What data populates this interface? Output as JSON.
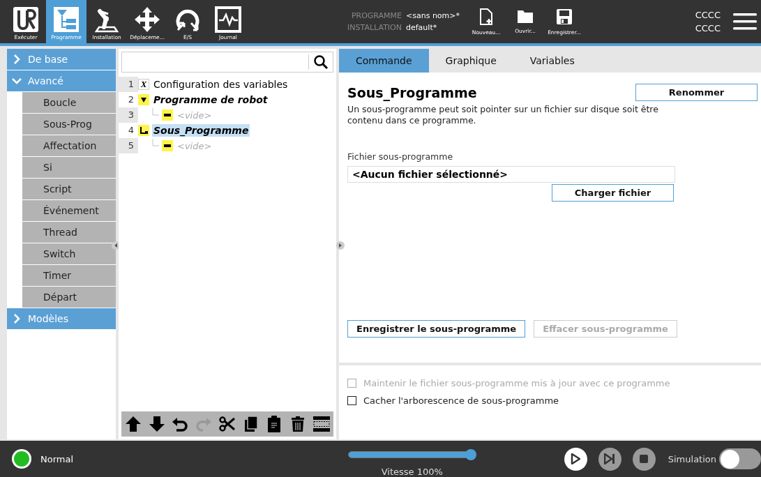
{
  "nav": [
    {
      "label": "Exécuter",
      "kind": "logo",
      "selected": false
    },
    {
      "label": "Programme",
      "kind": "tree",
      "selected": true
    },
    {
      "label": "Installation",
      "kind": "robot",
      "selected": false
    },
    {
      "label": "Déplaceme...",
      "kind": "move",
      "selected": false
    },
    {
      "label": "E/S",
      "kind": "io",
      "selected": false
    },
    {
      "label": "Journal",
      "kind": "log",
      "selected": false
    }
  ],
  "program_info": [
    {
      "label": "PROGRAMME",
      "value": "<sans nom>*"
    },
    {
      "label": "INSTALLATION",
      "value": "default*"
    }
  ],
  "file_actions": [
    {
      "label": "Nouveau...",
      "kind": "new"
    },
    {
      "label": "Ouvrir...",
      "kind": "open"
    },
    {
      "label": "Enregistrer...",
      "kind": "save"
    }
  ],
  "user": [
    "CCCC",
    "CCCC"
  ],
  "sidebar": [
    {
      "label": "De base",
      "expanded": false
    },
    {
      "label": "Avancé",
      "expanded": true,
      "children": [
        {
          "label": "Boucle"
        },
        {
          "label": "Sous-Prog"
        },
        {
          "label": "Affectation"
        },
        {
          "label": "Si"
        },
        {
          "label": "Script"
        },
        {
          "label": "Événement"
        },
        {
          "label": "Thread"
        },
        {
          "label": "Switch"
        },
        {
          "label": "Timer"
        },
        {
          "label": "Départ"
        }
      ]
    },
    {
      "label": "Modèles",
      "expanded": false
    }
  ],
  "tree": [
    {
      "number": "1",
      "label": "Configuration des variables",
      "kind": "variables",
      "symbol": "X",
      "selected": false
    },
    {
      "number": "2",
      "label": "Programme de robot",
      "kind": "program",
      "selected": false,
      "children": [
        {
          "number": "3",
          "label": "<vide>",
          "kind": "empty",
          "selected": false
        }
      ]
    },
    {
      "number": "4",
      "label": "Sous_Programme",
      "kind": "subprogram",
      "selected": true,
      "children": [
        {
          "number": "5",
          "label": "<vide>",
          "kind": "empty",
          "selected": false
        }
      ]
    }
  ],
  "tree_toolbar": [
    {
      "kind": "up",
      "disabled": false
    },
    {
      "kind": "down",
      "disabled": false
    },
    {
      "kind": "undo",
      "disabled": false
    },
    {
      "kind": "redo",
      "disabled": true
    },
    {
      "kind": "cut",
      "disabled": false
    },
    {
      "kind": "copy",
      "disabled": false
    },
    {
      "kind": "paste",
      "disabled": false
    },
    {
      "kind": "delete",
      "disabled": false
    },
    {
      "kind": "suppress",
      "disabled": false
    }
  ],
  "tabs": [
    {
      "label": "Commande",
      "selected": true
    },
    {
      "label": "Graphique",
      "selected": false
    },
    {
      "label": "Variables",
      "selected": false
    }
  ],
  "panel": {
    "title": "Sous_Programme",
    "rename_button": "Renommer",
    "description": "Un sous-programme peut soit pointer sur un fichier sur disque soit être contenu dans ce programme.",
    "file_label": "Fichier sous-programme",
    "file_value": "<Aucun fichier sélectionné>",
    "load_button": "Charger fichier",
    "actions": [
      {
        "label": "Enregistrer le sous-programme",
        "disabled": false
      },
      {
        "label": "Effacer sous-programme",
        "disabled": true
      }
    ],
    "options": [
      {
        "label": "Maintenir le fichier sous-programme mis à jour avec ce programme",
        "checked": false,
        "disabled": true
      },
      {
        "label": "Cacher l'arborescence de sous-programme",
        "checked": false,
        "disabled": false
      }
    ]
  },
  "status": {
    "label": "Normal"
  },
  "speed": {
    "level": 1.0,
    "label": "Vitesse 100%"
  },
  "controls": [
    {
      "kind": "play",
      "disabled": false
    },
    {
      "kind": "step",
      "disabled": true
    },
    {
      "kind": "stop",
      "disabled": true
    }
  ],
  "simulation": {
    "label": "Simulation",
    "on": false
  }
}
